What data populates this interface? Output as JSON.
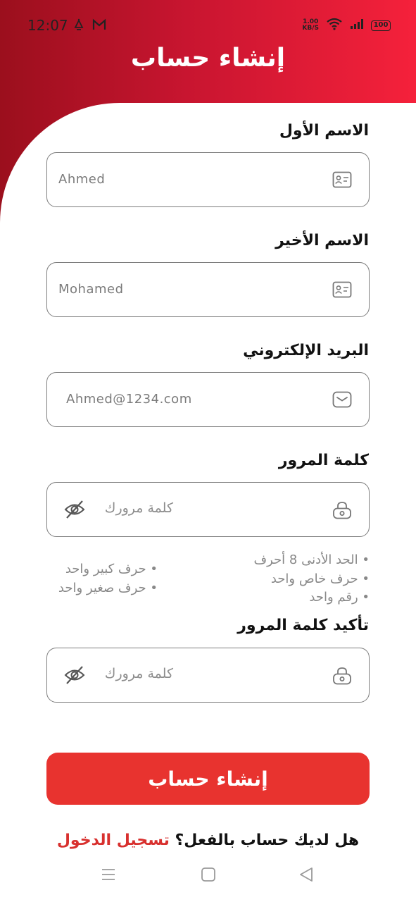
{
  "status_bar": {
    "time": "12:07",
    "net_speed_value": "1.00",
    "net_speed_unit": "KB/S",
    "battery": "100",
    "icons": [
      "alarm-icon",
      "gmail-icon",
      "wifi-icon",
      "signal-icon",
      "battery-icon"
    ]
  },
  "header": {
    "title": "إنشاء حساب"
  },
  "form": {
    "first_name": {
      "label": "الاسم الأول",
      "value": "Ahmed"
    },
    "last_name": {
      "label": "الاسم الأخير",
      "value": "Mohamed"
    },
    "email": {
      "label": "البريد الإلكتروني",
      "value": "Ahmed@1234.com"
    },
    "password": {
      "label": "كلمة المرور",
      "placeholder": "كلمة مرورك"
    },
    "password_rules": {
      "right": [
        "• الحد الأدنى 8 أحرف",
        "• حرف خاص واحد",
        "• رقم واحد"
      ],
      "left": [
        "• حرف كبير واحد",
        "• حرف صغير واحد"
      ]
    },
    "confirm_password": {
      "label": "تأكيد كلمة المرور",
      "placeholder": "كلمة مرورك"
    }
  },
  "submit_button": {
    "label": "إنشاء حساب"
  },
  "login_prompt": {
    "text": "هل لديك حساب بالفعل؟ ",
    "link": "تسجيل الدخول"
  },
  "colors": {
    "accent": "#e8332f",
    "header_dark": "#9b0f1d",
    "header_light": "#f5213b"
  }
}
